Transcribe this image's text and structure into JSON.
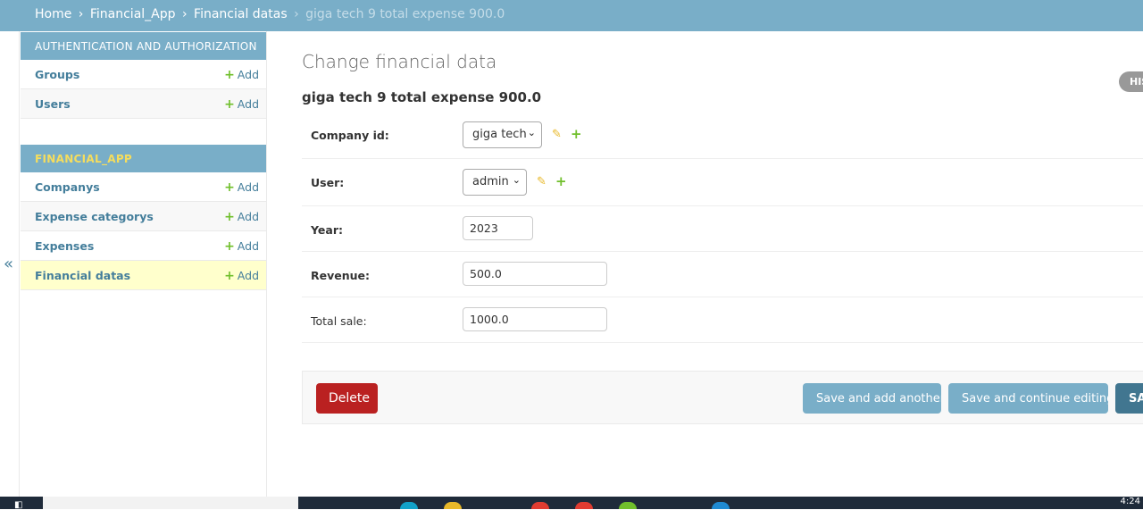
{
  "breadcrumbs": {
    "home": "Home",
    "app": "Financial_App",
    "model": "Financial datas",
    "current": "giga tech 9 total expense 900.0",
    "separator": "›"
  },
  "nav_toggle": "«",
  "sidebar": {
    "auth_caption": "AUTHENTICATION AND AUTHORIZATION",
    "auth_items": [
      {
        "label": "Groups",
        "add": "Add"
      },
      {
        "label": "Users",
        "add": "Add"
      }
    ],
    "app_caption": "FINANCIAL_APP",
    "app_items": [
      {
        "label": "Companys",
        "add": "Add"
      },
      {
        "label": "Expense categorys",
        "add": "Add"
      },
      {
        "label": "Expenses",
        "add": "Add"
      },
      {
        "label": "Financial datas",
        "add": "Add"
      }
    ],
    "plus_glyph": "+"
  },
  "main": {
    "page_title": "Change financial data",
    "object_title": "giga tech 9 total expense 900.0",
    "history_label": "HISTORY",
    "fields": {
      "company_label": "Company id:",
      "company_value": "giga tech",
      "user_label": "User:",
      "user_value": "admin",
      "year_label": "Year:",
      "year_value": "2023",
      "revenue_label": "Revenue:",
      "revenue_value": "500.0",
      "total_sale_label": "Total sale:",
      "total_sale_value": "1000.0"
    },
    "icons": {
      "pencil": "✎",
      "plus": "+",
      "caret": "⌄"
    }
  },
  "submit_row": {
    "delete": "Delete",
    "save_add_another": "Save and add another",
    "save_continue": "Save and continue editing",
    "save": "SAVE"
  },
  "taskbar": {
    "clock": "4:24"
  },
  "colors": {
    "header": "#79aec8",
    "link": "#447e9b",
    "delete": "#ba2121",
    "default_button": "#417690",
    "active_row": "#ffffcc"
  }
}
